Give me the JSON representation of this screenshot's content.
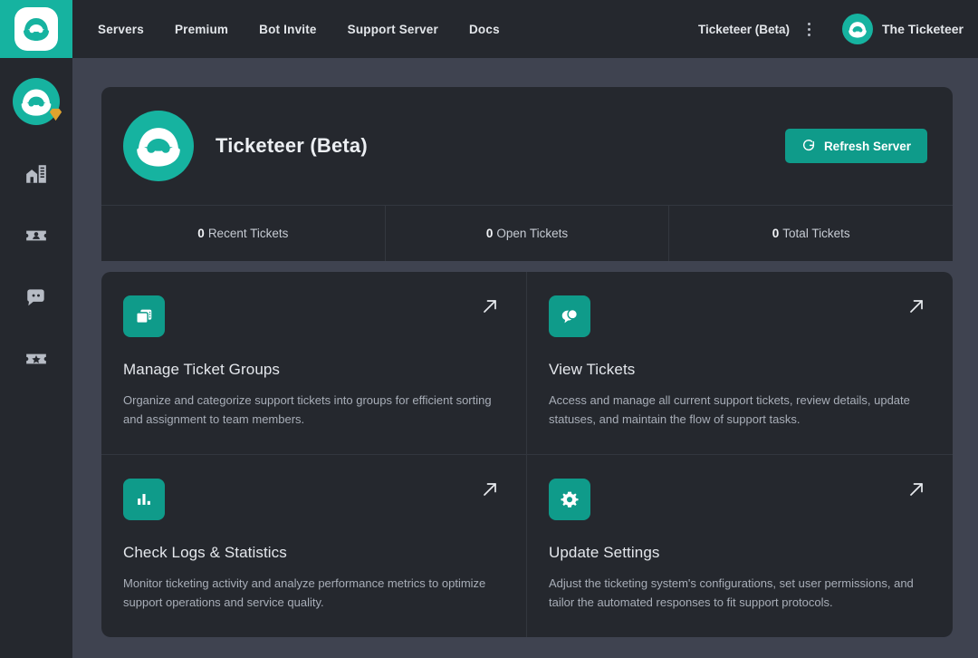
{
  "brand": {
    "logo_icon": "ticketeer-mascot-logo",
    "accent_color": "#16b3a0",
    "button_color": "#0f9b8a",
    "badge_color": "#e0a32e"
  },
  "topbar": {
    "nav": [
      {
        "label": "Servers"
      },
      {
        "label": "Premium"
      },
      {
        "label": "Bot Invite"
      },
      {
        "label": "Support Server"
      },
      {
        "label": "Docs"
      }
    ],
    "server_switcher_label": "Ticketeer (Beta)",
    "kebab_icon": "more-vertical-icon",
    "user": {
      "name": "The Ticketeer",
      "avatar_icon": "ticketeer-mascot-avatar"
    }
  },
  "sidebar": {
    "avatar": {
      "icon": "server-avatar",
      "badge_icon": "premium-diamond-badge"
    },
    "items": [
      {
        "icon": "home-building-icon",
        "name": "home"
      },
      {
        "icon": "ticket-person-icon",
        "name": "ticket-groups"
      },
      {
        "icon": "chat-bubble-icon",
        "name": "tickets"
      },
      {
        "icon": "ticket-star-icon",
        "name": "premium-tickets"
      }
    ]
  },
  "server_header": {
    "logo_icon": "server-logo",
    "title": "Ticketeer (Beta)",
    "refresh_button": {
      "label": "Refresh Server",
      "icon": "refresh-icon"
    }
  },
  "stats": [
    {
      "value": "0",
      "label": "Recent Tickets"
    },
    {
      "value": "0",
      "label": "Open Tickets"
    },
    {
      "value": "0",
      "label": "Total Tickets"
    }
  ],
  "tiles": [
    {
      "icon": "layers-copy-icon",
      "title": "Manage Ticket Groups",
      "description": "Organize and categorize support tickets into groups for efficient sorting and assignment to team members.",
      "arrow_icon": "arrow-up-right-icon"
    },
    {
      "icon": "chat-bubbles-icon",
      "title": "View Tickets",
      "description": "Access and manage all current support tickets, review details, update statuses, and maintain the flow of support tasks.",
      "arrow_icon": "arrow-up-right-icon"
    },
    {
      "icon": "bar-chart-icon",
      "title": "Check Logs & Statistics",
      "description": "Monitor ticketing activity and analyze performance metrics to optimize support operations and service quality.",
      "arrow_icon": "arrow-up-right-icon"
    },
    {
      "icon": "gear-icon",
      "title": "Update Settings",
      "description": "Adjust the ticketing system's configurations, set user permissions, and tailor the automated responses to fit support protocols.",
      "arrow_icon": "arrow-up-right-icon"
    }
  ]
}
